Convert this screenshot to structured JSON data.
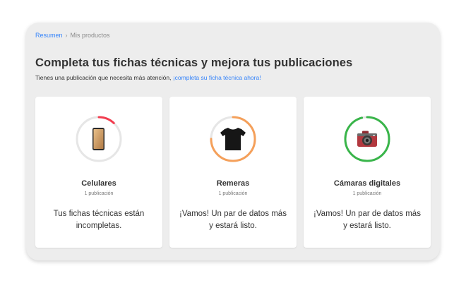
{
  "breadcrumb": {
    "home": "Resumen",
    "separator": "›",
    "current": "Mis productos"
  },
  "header": {
    "title": "Completa tus fichas técnicas y mejora tus publicaciones",
    "subtitle_text": "Tienes una publicación que necesita más atención, ",
    "subtitle_link": "¡completa su ficha técnica ahora!"
  },
  "colors": {
    "link": "#3483fa",
    "incomplete": "#f23d4f",
    "partial": "#f5a05a",
    "complete": "#39b54a",
    "ring_track": "#e6e6e6"
  },
  "cards": [
    {
      "name": "Celulares",
      "count": "1 publicación",
      "message": "Tus fichas técnicas están incompletas.",
      "progress": 0.12,
      "ring_color": "#f23d4f",
      "icon": "smartphone-icon"
    },
    {
      "name": "Remeras",
      "count": "1 publicación",
      "message": "¡Vamos! Un par de datos más y estará listo.",
      "progress": 0.75,
      "ring_color": "#f5a05a",
      "icon": "tshirt-icon"
    },
    {
      "name": "Cámaras digitales",
      "count": "1 publicación",
      "message": "¡Vamos! Un par de datos más y estará listo.",
      "progress": 0.96,
      "ring_color": "#39b54a",
      "icon": "camera-icon"
    }
  ]
}
